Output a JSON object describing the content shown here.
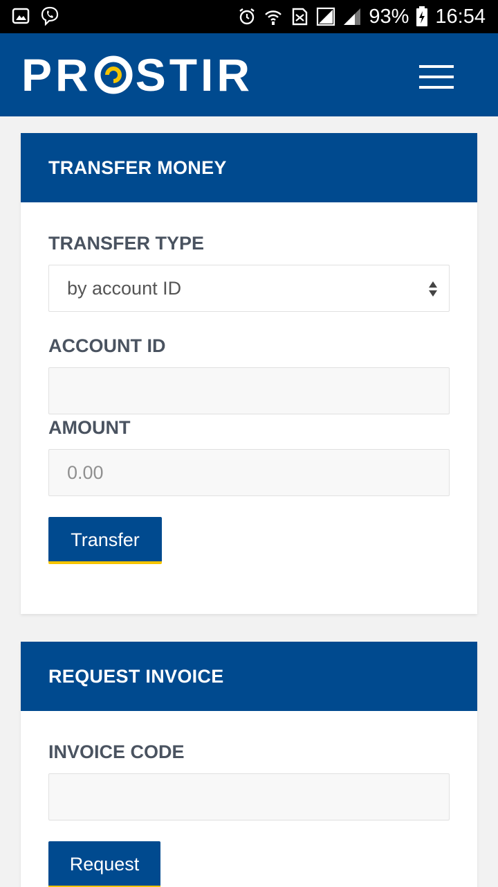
{
  "status_bar": {
    "battery": "93%",
    "time": "16:54",
    "left_icons": [
      "gallery-icon",
      "viber-icon"
    ],
    "right_icons": [
      "alarm-icon",
      "wifi-icon",
      "sim-icon",
      "signal-icon",
      "battery-charging-icon"
    ]
  },
  "header": {
    "logo_text_left": "PR",
    "logo_text_right": "STIR",
    "logo_accent_color": "#f5c400",
    "menu_icon": "hamburger-menu-icon",
    "background": "#004a8f"
  },
  "transfer": {
    "title": "TRANSFER MONEY",
    "type_label": "TRANSFER TYPE",
    "type_value": "by account ID",
    "account_label": "ACCOUNT ID",
    "account_value": "",
    "amount_label": "AMOUNT",
    "amount_placeholder": "0.00",
    "button": "Transfer"
  },
  "invoice": {
    "title": "REQUEST INVOICE",
    "code_label": "INVOICE CODE",
    "code_value": "",
    "button": "Request"
  }
}
